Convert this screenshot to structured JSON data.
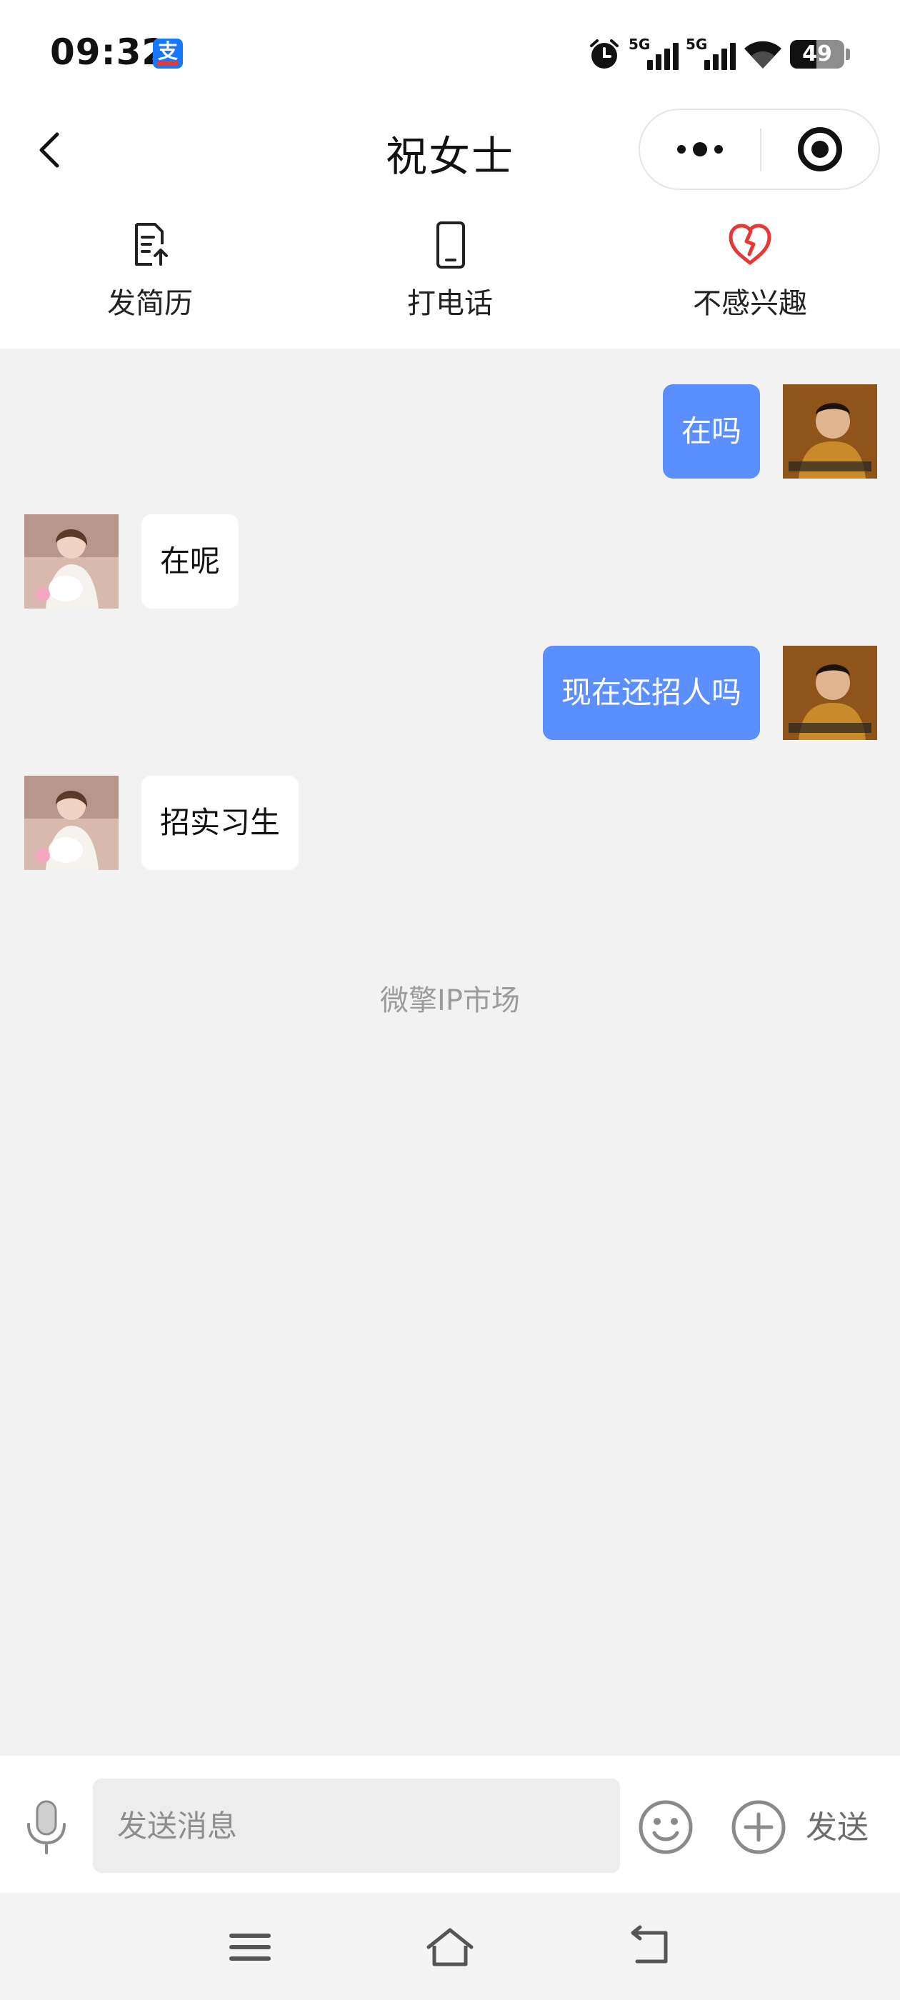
{
  "status_bar": {
    "time": "09:32",
    "app_badge": "支",
    "signal1_label": "5G",
    "signal2_label": "5G",
    "battery_text": "49",
    "battery_level": 0.49
  },
  "nav": {
    "title": "祝女士"
  },
  "actions": [
    {
      "label": "发简历",
      "icon": "resume-upload-icon"
    },
    {
      "label": "打电话",
      "icon": "phone-icon"
    },
    {
      "label": "不感兴趣",
      "icon": "broken-heart-icon",
      "color": "#e53935"
    }
  ],
  "messages": [
    {
      "from": "me",
      "text": "在吗"
    },
    {
      "from": "other",
      "text": "在呢"
    },
    {
      "from": "me",
      "text": "现在还招人吗"
    },
    {
      "from": "other",
      "text": "招实习生"
    }
  ],
  "footer_note": "微擎IP市场",
  "input": {
    "placeholder": "发送消息",
    "value": "",
    "send_label": "发送"
  },
  "colors": {
    "my_bubble": "#5b8fff",
    "other_bubble": "#ffffff",
    "chat_background": "#f3f2f3"
  }
}
